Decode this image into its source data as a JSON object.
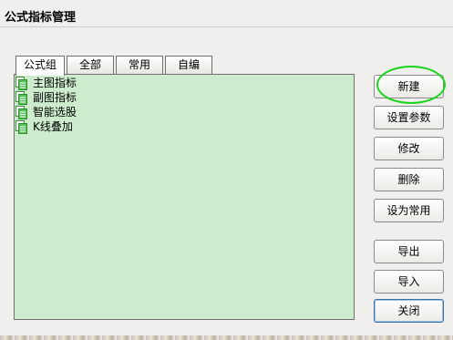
{
  "window": {
    "title": "公式指标管理"
  },
  "tabs": [
    {
      "label": "公式组",
      "active": true
    },
    {
      "label": "全部",
      "active": false
    },
    {
      "label": "常用",
      "active": false
    },
    {
      "label": "自编",
      "active": false
    }
  ],
  "tree": {
    "items": [
      {
        "label": "主图指标",
        "icon": "folder-document-icon"
      },
      {
        "label": "副图指标",
        "icon": "folder-document-icon"
      },
      {
        "label": "智能选股",
        "icon": "folder-document-icon"
      },
      {
        "label": "K线叠加",
        "icon": "folder-document-icon"
      }
    ]
  },
  "buttons": {
    "new": "新建",
    "set_params": "设置参数",
    "modify": "修改",
    "delete": "删除",
    "set_common": "设为常用",
    "export": "导出",
    "import": "导入",
    "close": "关闭"
  },
  "colors": {
    "panel_bg": "#cdebcd",
    "highlight_circle": "#1ad41a",
    "icon_green": "#3aa83a"
  }
}
